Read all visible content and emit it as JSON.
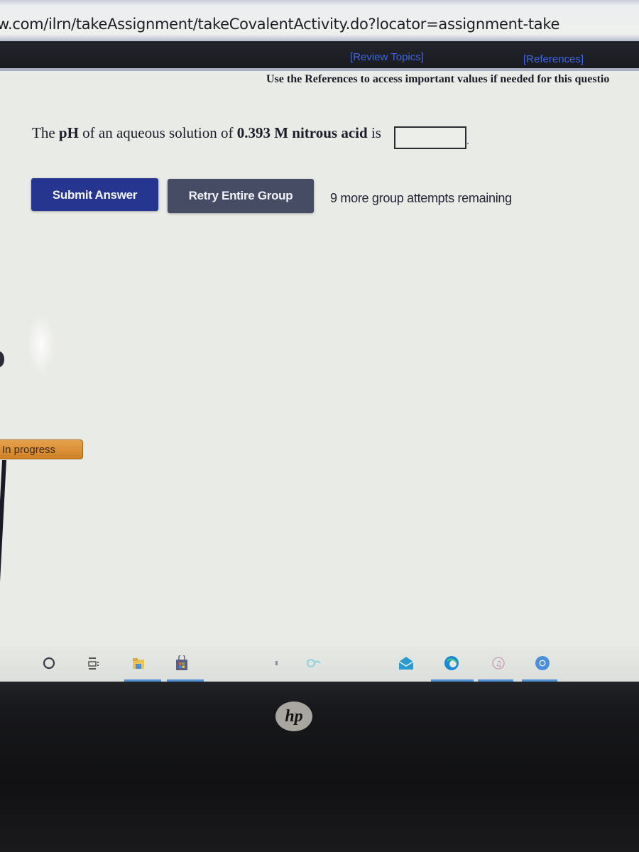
{
  "browser": {
    "url": "w.com/ilrn/takeAssignment/takeCovalentActivity.do?locator=assignment-take"
  },
  "nav": {
    "review_topics": "[Review Topics]",
    "references": "[References]"
  },
  "references_note": "Use the References to access important values if needed for this questio",
  "question": {
    "part1": "The ",
    "ph": "pH",
    "part2": " of an aqueous solution of ",
    "concentration": "0.393 M",
    "part3": " ",
    "compound": "nitrous acid",
    "part4": " is",
    "answer_value": "",
    "answer_placeholder": "",
    "period": "."
  },
  "actions": {
    "submit_label": "Submit Answer",
    "retry_label": "Retry Entire Group",
    "attempts_text": "9 more group attempts remaining"
  },
  "status": {
    "label": "In progress",
    "color": "#d98a33"
  },
  "taskbar": {
    "icons": [
      {
        "name": "search-circle-icon"
      },
      {
        "name": "task-view-icon"
      },
      {
        "name": "file-explorer-icon"
      },
      {
        "name": "store-icon"
      },
      {
        "name": "cortana-icon"
      },
      {
        "name": "mail-icon"
      },
      {
        "name": "edge-icon"
      },
      {
        "name": "itunes-icon"
      },
      {
        "name": "chrome-icon"
      }
    ]
  },
  "device": {
    "brand": "hp"
  },
  "colors": {
    "submit_button": "#26358f",
    "retry_button": "#454c63",
    "link": "#3c67e6",
    "status_badge": "#d98a33"
  }
}
